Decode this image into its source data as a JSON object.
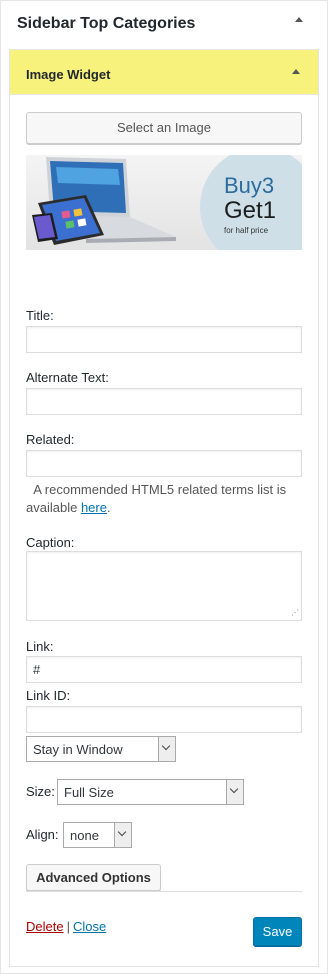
{
  "panel": {
    "title": "Sidebar Top Categories",
    "toggle_icon": "triangle-up-icon"
  },
  "widget": {
    "title": "Image Widget",
    "toggle_icon": "triangle-up-icon",
    "highlight_color": "#f6f27c",
    "select_image_label": "Select an Image",
    "image_preview": {
      "promo_line1": "Buy3",
      "promo_line2": "Get1",
      "promo_line3": "for half price"
    },
    "fields": {
      "title": {
        "label": "Title:",
        "value": ""
      },
      "alt_text": {
        "label": "Alternate Text:",
        "value": ""
      },
      "related": {
        "label": "Related:",
        "value": "",
        "help_text": "A recommended HTML5 related terms list is available",
        "help_link": "here",
        "help_suffix": "."
      },
      "caption": {
        "label": "Caption:",
        "value": ""
      },
      "link": {
        "label": "Link:",
        "value": "#"
      },
      "link_id": {
        "label": "Link ID:",
        "value": ""
      },
      "link_target": {
        "selected": "Stay in Window"
      },
      "size": {
        "label": "Size:",
        "selected": "Full Size"
      },
      "align": {
        "label": "Align:",
        "selected": "none"
      }
    },
    "advanced_label": "Advanced Options",
    "footer": {
      "delete_label": "Delete",
      "separator": "|",
      "close_label": "Close",
      "save_label": "Save"
    },
    "colors": {
      "save_button": "#0085ba",
      "delete_link": "#aa0000",
      "link": "#0073aa"
    }
  }
}
